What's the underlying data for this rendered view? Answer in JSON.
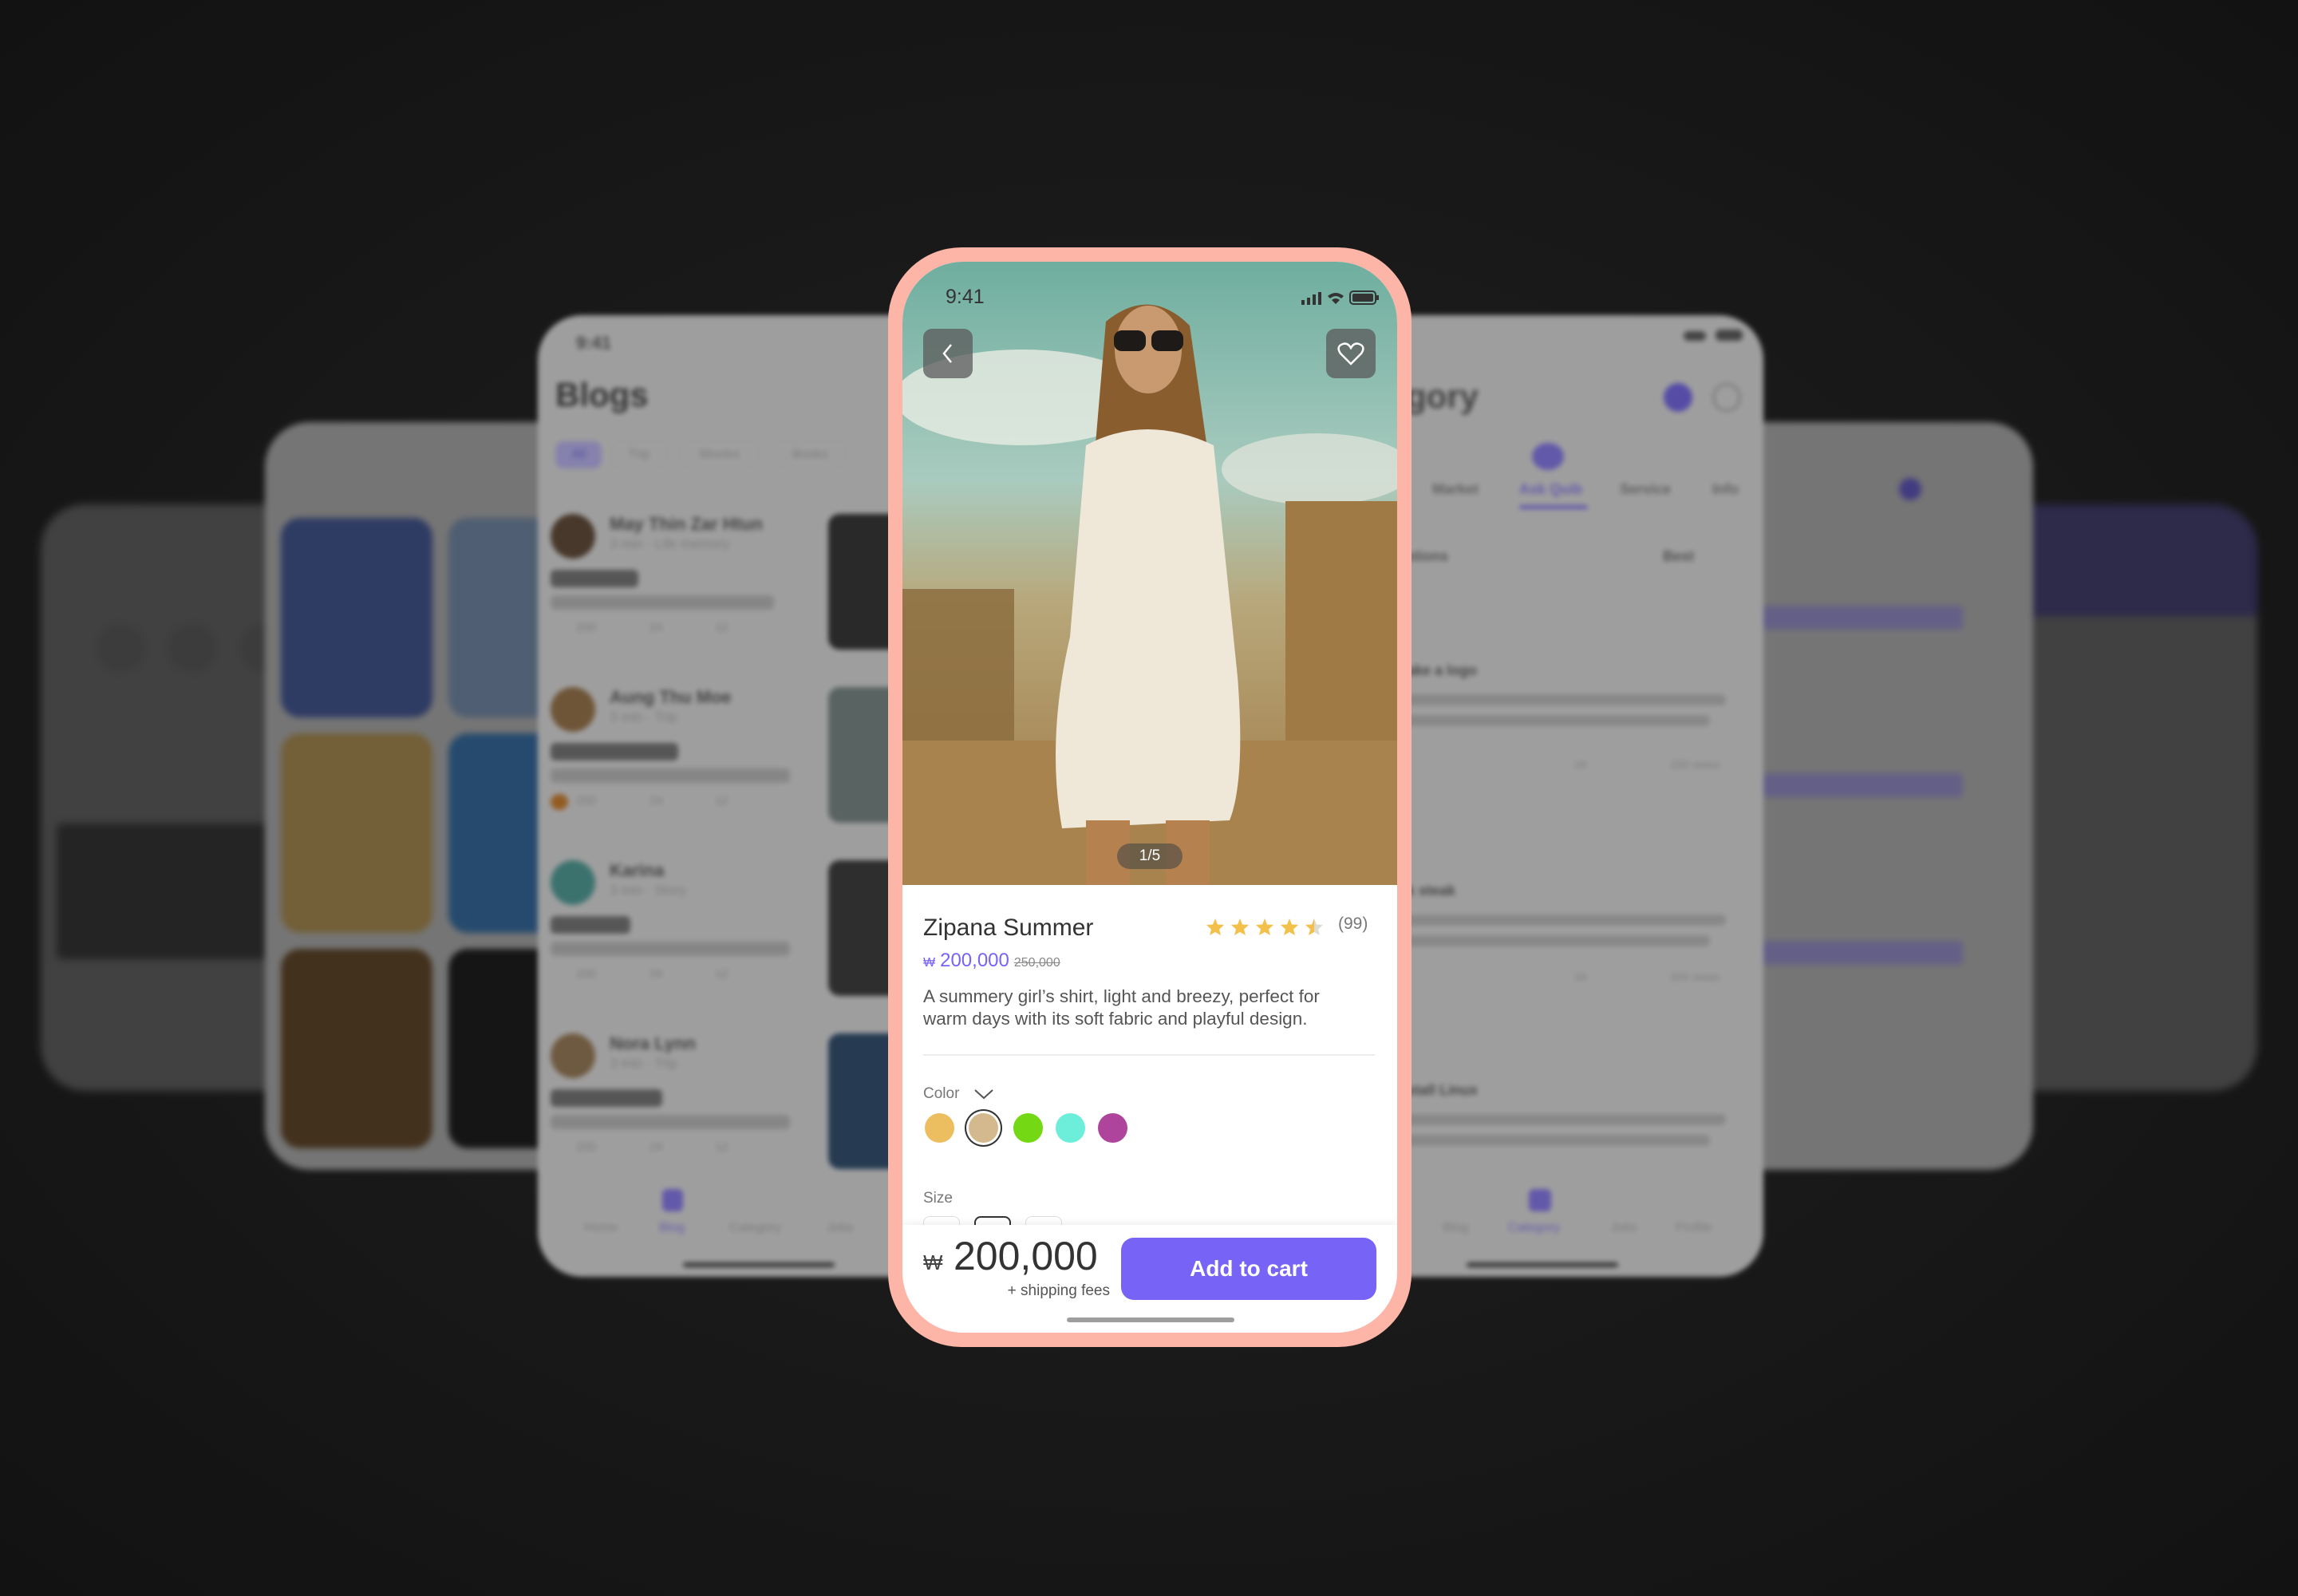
{
  "status_bar": {
    "time": "9:41"
  },
  "product": {
    "image_counter": "1/5",
    "title": "Zipana Summer",
    "rating": 4.5,
    "rating_count": "(99)",
    "currency": "₩",
    "price": "200,000",
    "old_price": "250,000",
    "description_line1": "A summery girl’s shirt, light and breezy, perfect for",
    "description_line2": "warm days with its soft fabric and playful design.",
    "color_label": "Color",
    "colors": [
      "#EDBE5F",
      "#D4B98E",
      "#74D914",
      "#6CEEDB",
      "#AE449C"
    ],
    "selected_color_index": 1,
    "size_label": "Size",
    "total_price": "200,000",
    "shipping_note": "+ shipping fees",
    "add_to_cart": "Add to cart"
  },
  "colors": {
    "accent": "#7763F5",
    "frame": "#FDB5A8",
    "star": "#F4C04C"
  },
  "blogs_screen": {
    "time": "9:41",
    "title": "Blogs",
    "tabs": [
      "All",
      "Trip",
      "Movies",
      "Books"
    ],
    "posts": [
      {
        "author": "May Thin Zar Htun",
        "meta": "3 min · Life memory",
        "likes": "200",
        "comments": "24",
        "shares": "12"
      },
      {
        "author": "Aung Thu Moe",
        "meta": "3 min · Trip",
        "likes": "200",
        "comments": "24",
        "shares": "12"
      },
      {
        "author": "Karina",
        "meta": "3 min · Story",
        "likes": "200",
        "comments": "24",
        "shares": "12"
      },
      {
        "author": "Nora Lynn",
        "meta": "3 min · Trip",
        "likes": "200",
        "comments": "24",
        "shares": "12"
      }
    ],
    "nav": [
      "Home",
      "Blog",
      "Category",
      "Jobs"
    ]
  },
  "category_screen": {
    "title": "gory",
    "tabs": [
      "Market",
      "Ask Quib",
      "Service",
      "Info"
    ],
    "section": "stions",
    "sort": "Best",
    "cards": [
      {
        "title": "ake a logo",
        "views": "200 views",
        "comments": "24"
      },
      {
        "title": "k steak",
        "views": "200 views",
        "comments": "24"
      },
      {
        "title": "stall Linux",
        "views": "",
        "comments": ""
      }
    ],
    "nav": [
      "Blog",
      "Category",
      "Jobs",
      "Profile"
    ]
  }
}
